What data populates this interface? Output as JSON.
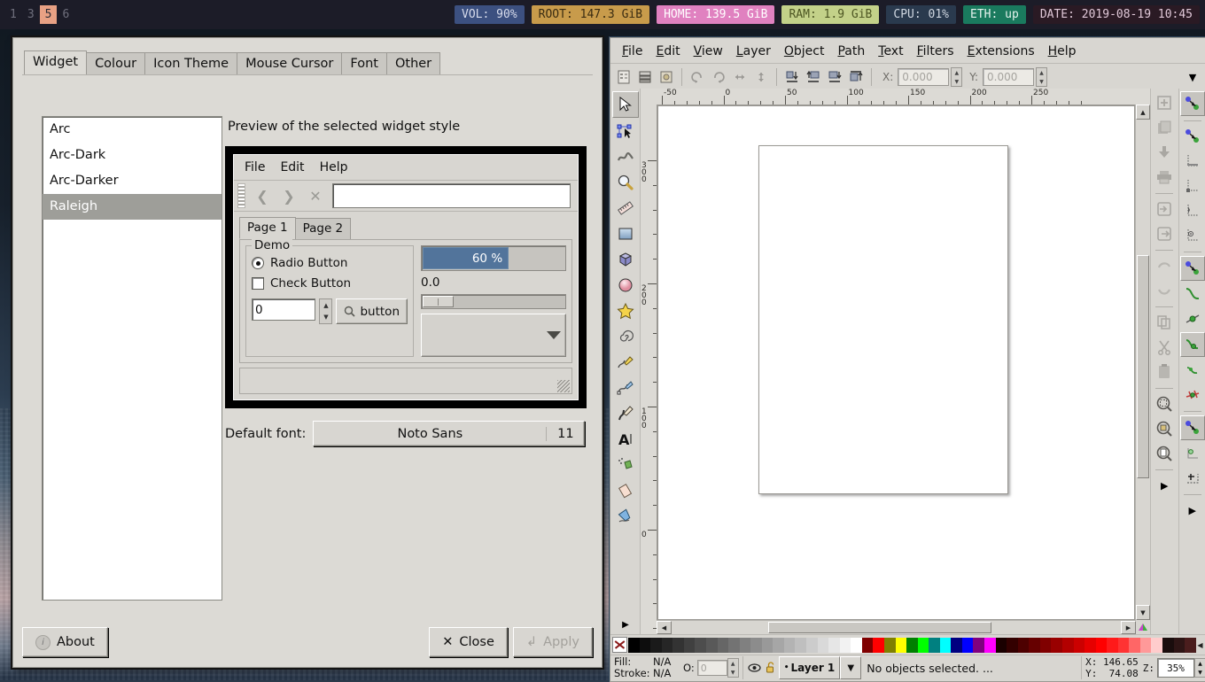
{
  "topbar": {
    "workspaces": [
      {
        "label": "1",
        "active": false
      },
      {
        "label": "3",
        "active": false
      },
      {
        "label": "5",
        "active": true
      },
      {
        "label": "6",
        "active": false
      }
    ],
    "blocks": [
      {
        "name": "volume",
        "label": "VOL: 90%",
        "bg": "#3c5080",
        "fg": "#d8dcec"
      },
      {
        "name": "root-disk",
        "label": "ROOT: 147.3 GiB",
        "bg": "#c89b4b",
        "fg": "#3a2c12"
      },
      {
        "name": "home-disk",
        "label": "HOME: 139.5 GiB",
        "bg": "#e081c0",
        "fg": "#ffffff"
      },
      {
        "name": "ram",
        "label": "RAM: 1.9 GiB",
        "bg": "#c3d189",
        "fg": "#4c5522"
      },
      {
        "name": "cpu",
        "label": "CPU: 01%",
        "bg": "#2a3a4e",
        "fg": "#cfd6e0"
      },
      {
        "name": "ethernet",
        "label": "ETH: up",
        "bg": "#1a7a5e",
        "fg": "#e6f3ee"
      },
      {
        "name": "date",
        "label": "DATE: 2019-08-19 10:45",
        "bg": "#2a1a24",
        "fg": "#e0c8d8"
      }
    ]
  },
  "appearance_dialog": {
    "tabs": [
      {
        "label": "Widget",
        "active": true
      },
      {
        "label": "Colour",
        "active": false
      },
      {
        "label": "Icon Theme",
        "active": false
      },
      {
        "label": "Mouse Cursor",
        "active": false
      },
      {
        "label": "Font",
        "active": false
      },
      {
        "label": "Other",
        "active": false
      }
    ],
    "theme_list": [
      {
        "label": "Arc",
        "selected": false
      },
      {
        "label": "Arc-Dark",
        "selected": false
      },
      {
        "label": "Arc-Darker",
        "selected": false
      },
      {
        "label": "Raleigh",
        "selected": true
      }
    ],
    "preview_label": "Preview of the selected widget style",
    "preview": {
      "menu": [
        "File",
        "Edit",
        "Help"
      ],
      "nav": [
        "back-icon",
        "forward-icon",
        "stop-icon"
      ],
      "entry_value": "",
      "tabs": [
        {
          "label": "Page 1",
          "active": true
        },
        {
          "label": "Page 2",
          "active": false
        }
      ],
      "frame_title": "Demo",
      "radio_label": "Radio Button",
      "radio_checked": true,
      "check_label": "Check Button",
      "check_checked": false,
      "spin_value": "0",
      "button_label": "button",
      "progress_text": "60 %",
      "progress_percent": 60,
      "scale_label": "0.0",
      "scale_percent": 4,
      "combo_value": ""
    },
    "font": {
      "label": "Default font:",
      "name": "Noto Sans",
      "size": "11"
    },
    "buttons": {
      "about": "About",
      "close": "Close",
      "apply": "Apply",
      "apply_disabled": true
    }
  },
  "inkscape": {
    "menu": [
      "File",
      "Edit",
      "View",
      "Layer",
      "Object",
      "Path",
      "Text",
      "Filters",
      "Extensions",
      "Help"
    ],
    "commands_bar": {
      "icons": [
        "xml-editor-icon",
        "layers-icon",
        "document-properties-icon",
        "rotate-ccw-icon",
        "rotate-cw-icon",
        "flip-horizontal-icon",
        "flip-vertical-icon",
        "raise-to-top-icon",
        "raise-icon",
        "lower-icon",
        "lower-to-bottom-icon"
      ],
      "x_label": "X:",
      "x_value": "0.000",
      "y_label": "Y:",
      "y_value": "0.000",
      "overflow_icon": "chevron-down-icon"
    },
    "toolbox": [
      {
        "name": "selector-tool",
        "selected": true
      },
      {
        "name": "node-tool",
        "selected": false
      },
      {
        "name": "tweak-tool",
        "selected": false
      },
      {
        "name": "zoom-tool",
        "selected": false
      },
      {
        "name": "measure-tool",
        "selected": false
      },
      {
        "name": "rectangle-tool",
        "selected": false
      },
      {
        "name": "3dbox-tool",
        "selected": false
      },
      {
        "name": "ellipse-tool",
        "selected": false
      },
      {
        "name": "star-tool",
        "selected": false
      },
      {
        "name": "spiral-tool",
        "selected": false
      },
      {
        "name": "pencil-tool",
        "selected": false
      },
      {
        "name": "bezier-tool",
        "selected": false
      },
      {
        "name": "calligraphy-tool",
        "selected": false
      },
      {
        "name": "text-tool",
        "selected": false
      },
      {
        "name": "spray-tool",
        "selected": false
      },
      {
        "name": "eraser-tool",
        "selected": false
      },
      {
        "name": "paint-bucket-tool",
        "selected": false
      }
    ],
    "ruler_h_labels": [
      "-50",
      "0",
      "50",
      "100",
      "150",
      "200",
      "250"
    ],
    "ruler_v_labels": [
      "300",
      "200",
      "100",
      "0"
    ],
    "snap_bar": [
      {
        "name": "enable-snapping-icon",
        "selected": true
      },
      {
        "name": "snap-bounding-box-icon",
        "selected": false
      },
      {
        "name": "snap-bbox-edge-icon",
        "selected": false
      },
      {
        "name": "snap-bbox-corner-icon",
        "selected": false
      },
      {
        "name": "snap-bbox-edge-midpoint-icon",
        "selected": false
      },
      {
        "name": "snap-bbox-center-icon",
        "selected": false
      },
      {
        "name": "snap-nodes-paths-icon",
        "selected": true
      },
      {
        "name": "snap-path-icon",
        "selected": true
      },
      {
        "name": "snap-path-intersection-icon",
        "selected": false
      },
      {
        "name": "snap-cusp-node-icon",
        "selected": false
      },
      {
        "name": "snap-smooth-node-icon",
        "selected": false
      },
      {
        "name": "snap-midpoint-icon",
        "selected": false
      },
      {
        "name": "snap-others-icon",
        "selected": true
      },
      {
        "name": "snap-object-center-icon",
        "selected": false
      },
      {
        "name": "snap-rotation-center-icon",
        "selected": false
      }
    ],
    "command_dock": [
      {
        "name": "new-document-icon"
      },
      {
        "name": "open-document-icon"
      },
      {
        "name": "save-document-icon"
      },
      {
        "name": "print-document-icon"
      },
      {
        "name": "import-icon"
      },
      {
        "name": "export-icon"
      },
      {
        "name": "undo-icon"
      },
      {
        "name": "redo-icon"
      },
      {
        "name": "copy-icon"
      },
      {
        "name": "cut-icon"
      },
      {
        "name": "paste-icon"
      },
      {
        "name": "zoom-selection-icon"
      },
      {
        "name": "zoom-drawing-icon"
      },
      {
        "name": "zoom-page-icon"
      }
    ],
    "palette_colors": [
      "#000000",
      "#0d0d0d",
      "#1a1a1a",
      "#262626",
      "#333333",
      "#404040",
      "#4d4d4d",
      "#595959",
      "#666666",
      "#737373",
      "#808080",
      "#8c8c8c",
      "#999999",
      "#a6a6a6",
      "#b3b3b3",
      "#bfbfbf",
      "#cccccc",
      "#d9d9d9",
      "#e6e6e6",
      "#f2f2f2",
      "#ffffff",
      "#800000",
      "#ff0000",
      "#808000",
      "#ffff00",
      "#008000",
      "#00ff00",
      "#008080",
      "#00ffff",
      "#000080",
      "#0000ff",
      "#800080",
      "#ff00ff",
      "#1a0000",
      "#330000",
      "#4d0000",
      "#660000",
      "#800000",
      "#990000",
      "#b30000",
      "#cc0000",
      "#e60000",
      "#ff0000",
      "#ff1a1a",
      "#ff3333",
      "#ff6666",
      "#ff9999",
      "#ffcccc",
      "#1a0d0d",
      "#2e1515",
      "#4a1d1d"
    ],
    "status": {
      "fill_label": "Fill:",
      "fill_value": "N/A",
      "stroke_label": "Stroke:",
      "stroke_value": "N/A",
      "opacity_label": "O:",
      "opacity_value": "0",
      "eye_icon": "hide-layer-icon",
      "lock_icon": "unlock-layer-icon",
      "layer_name": "Layer 1",
      "layer_arrow_icon": "chevron-down-icon",
      "message": "No objects selected. ...",
      "x_label": "X:",
      "x_value": "146.65",
      "y_label": "Y:",
      "y_value": "74.08",
      "zoom_label": "Z:",
      "zoom_value": "35%"
    }
  }
}
